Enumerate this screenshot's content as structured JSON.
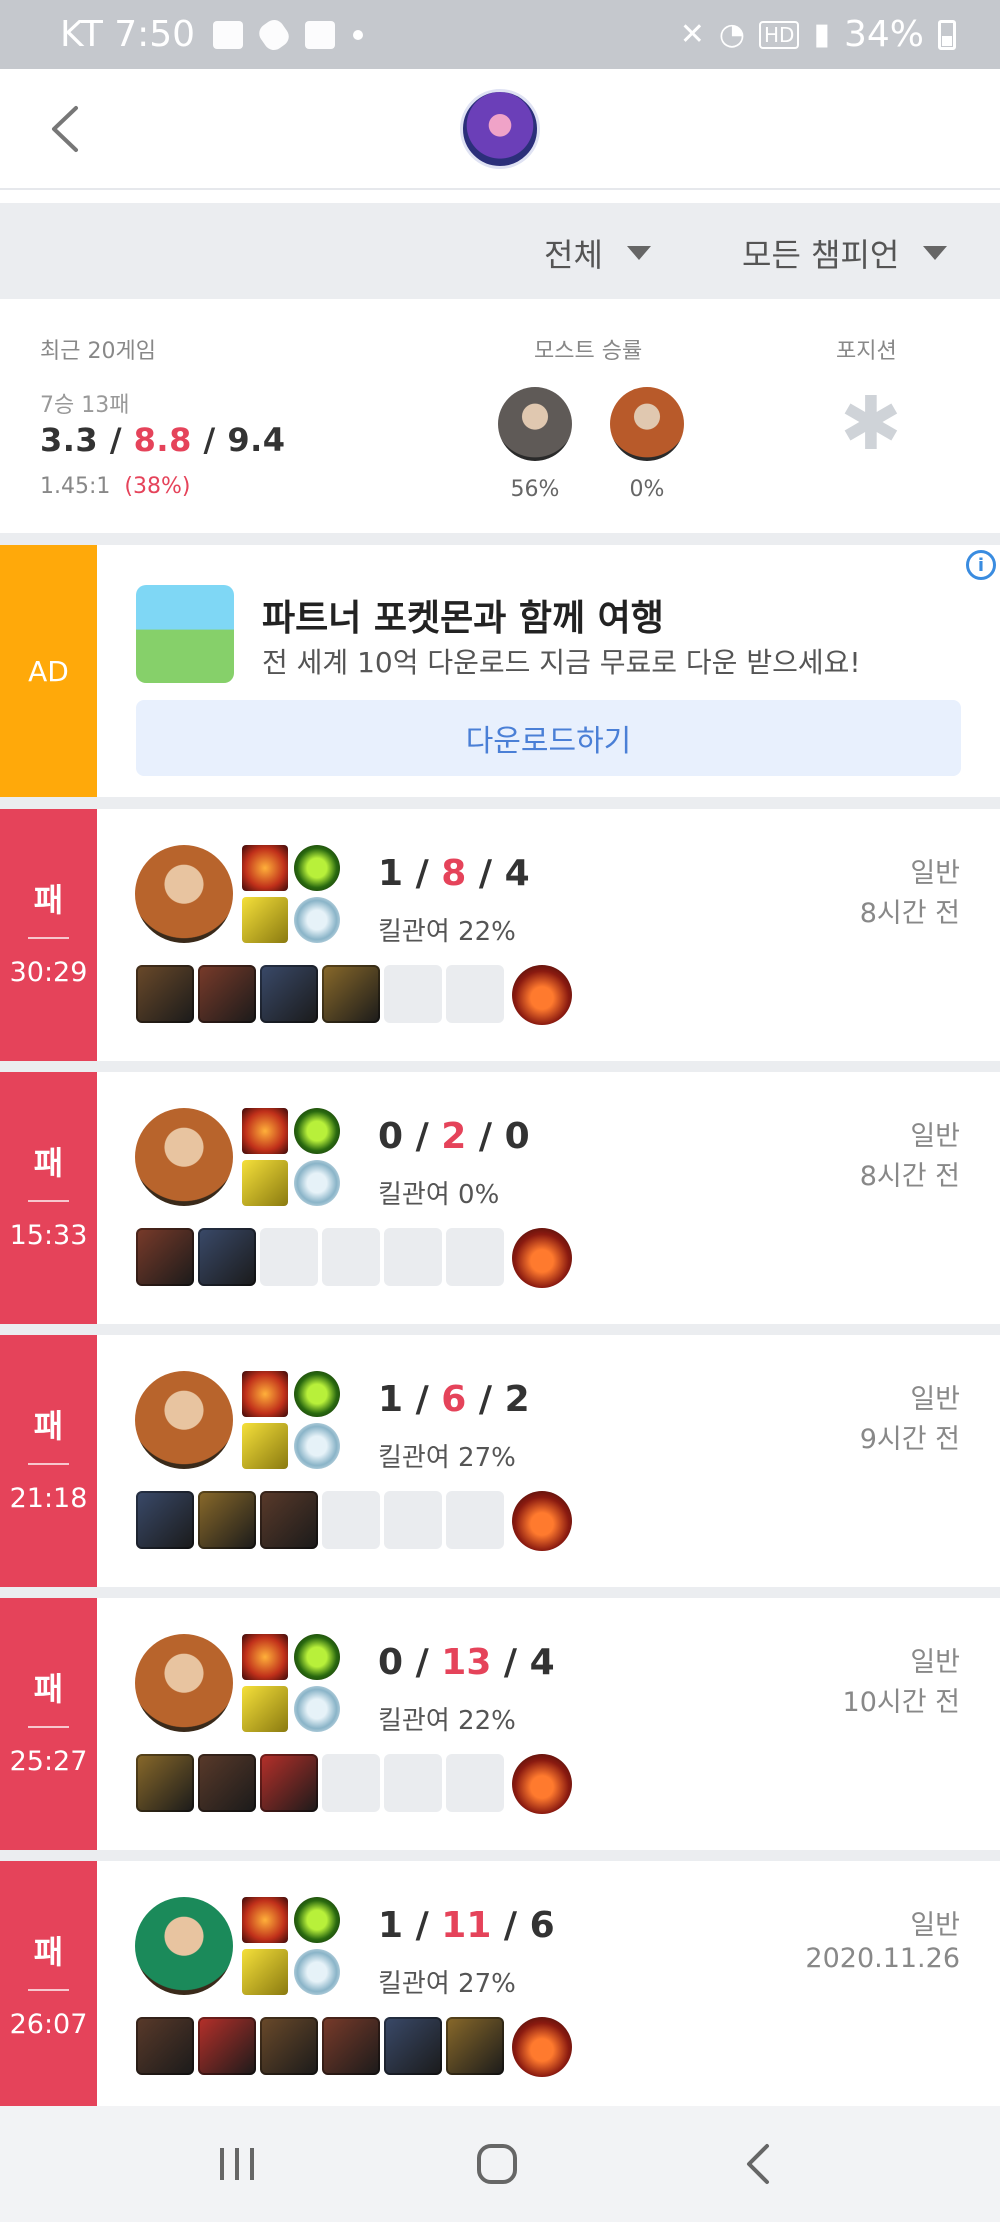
{
  "status_bar": {
    "carrier_time": "KT 7:50",
    "battery": "34%"
  },
  "filters": {
    "queue": "전체",
    "champion": "모든 챔피언"
  },
  "summary": {
    "recent_label": "최근 20게임",
    "record": "7승 13패",
    "kda": {
      "k": "3.3",
      "d": "8.8",
      "a": "9.4"
    },
    "ratio": "1.45:1",
    "winrate": "(38%)",
    "most_label": "모스트 승률",
    "most": [
      {
        "pct": "56%",
        "color": "#5f5a57"
      },
      {
        "pct": "0%",
        "color": "#b85a2a"
      }
    ],
    "position_label": "포지션",
    "position_icon": "asterisk-icon"
  },
  "ad": {
    "badge": "AD",
    "title": "파트너 포켓몬과 함께 여행",
    "subtitle": "전 세계 10억 다운로드 지금 무료로 다운 받으세요!",
    "button": "다운로드하기"
  },
  "matches": [
    {
      "result": "패",
      "duration": "30:29",
      "k": "1",
      "d": "8",
      "a": "4",
      "kp": "킬관여 22%",
      "mode": "일반",
      "when": "8시간 전",
      "champ_color": "#b8642c",
      "items_filled": 4
    },
    {
      "result": "패",
      "duration": "15:33",
      "k": "0",
      "d": "2",
      "a": "0",
      "kp": "킬관여 0%",
      "mode": "일반",
      "when": "8시간 전",
      "champ_color": "#b8642c",
      "items_filled": 2
    },
    {
      "result": "패",
      "duration": "21:18",
      "k": "1",
      "d": "6",
      "a": "2",
      "kp": "킬관여 27%",
      "mode": "일반",
      "when": "9시간 전",
      "champ_color": "#b8642c",
      "items_filled": 3
    },
    {
      "result": "패",
      "duration": "25:27",
      "k": "0",
      "d": "13",
      "a": "4",
      "kp": "킬관여 22%",
      "mode": "일반",
      "when": "10시간 전",
      "champ_color": "#b8642c",
      "items_filled": 3
    },
    {
      "result": "패",
      "duration": "26:07",
      "k": "1",
      "d": "11",
      "a": "6",
      "kp": "킬관여 27%",
      "mode": "일반",
      "when": "2020.11.26",
      "champ_color": "#1b8a5a",
      "items_filled": 6
    }
  ],
  "colors": {
    "loss": "#e5435a",
    "ad": "#ffa90a",
    "link": "#4a7fd6"
  }
}
